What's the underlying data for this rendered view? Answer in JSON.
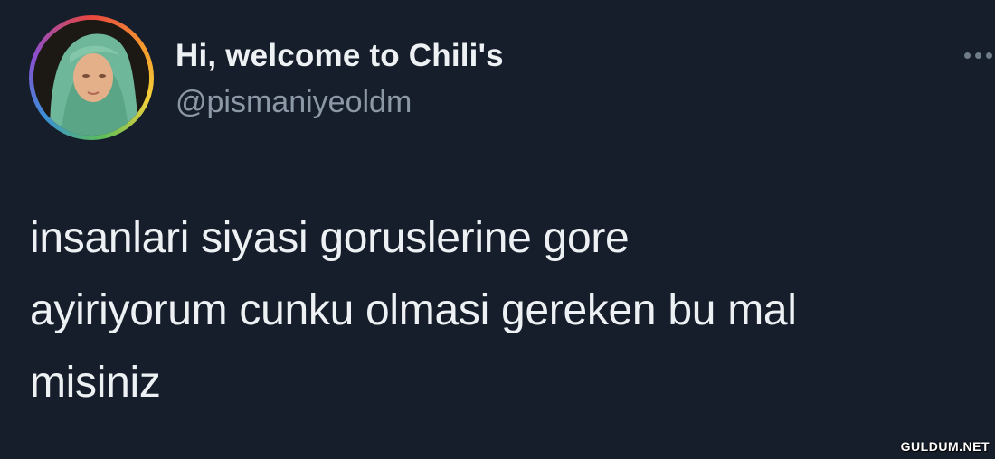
{
  "tweet": {
    "display_name": "Hi, welcome to Chili's",
    "handle": "@pismaniyeoldm",
    "avatar": "avatar-photo-child-green-headscarf",
    "more_icon": "more-horizontal-icon",
    "text_lines": [
      "insanlari siyasi goruslerine gore",
      "ayiriyorum cunku olmasi gereken bu mal",
      "misiniz"
    ]
  },
  "watermark": "GULDUM.NET",
  "colors": {
    "background": "#161e2b",
    "text_primary": "#eef1f4",
    "text_secondary": "#8c98a6"
  }
}
